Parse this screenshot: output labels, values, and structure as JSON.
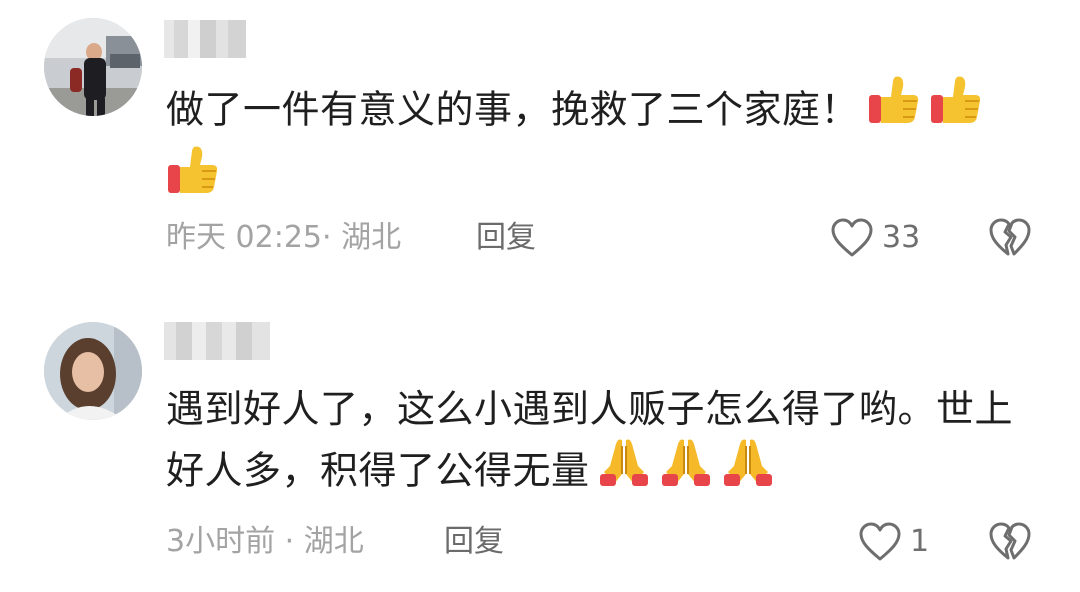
{
  "comments": [
    {
      "text": "做了一件有意义的事，挽救了三个家庭！",
      "emoji_name": "thumbs-up-emoji",
      "emoji_count": 3,
      "time": "昨天 02:25",
      "location": "· 湖北",
      "reply_label": "回复",
      "like_count": "33"
    },
    {
      "text": "遇到好人了，这么小遇到人贩子怎么得了哟。世上好人多，积得了公得无量",
      "emoji_name": "folded-hands-emoji",
      "emoji_count": 3,
      "time": "3小时前",
      "location": "· 湖北",
      "reply_label": "回复",
      "like_count": "1"
    }
  ],
  "icons": {
    "like": "heart-outline-icon",
    "dislike": "broken-heart-icon"
  },
  "colors": {
    "text": "#1f1f1f",
    "meta": "#a3a3a3",
    "reply": "#6b6b6b",
    "icon": "#6e6e6e"
  }
}
